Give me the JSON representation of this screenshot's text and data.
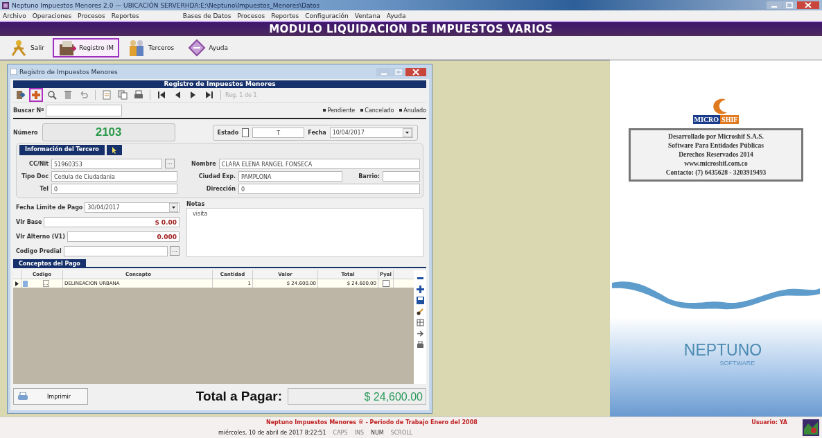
{
  "window": {
    "title": "Neptuno Impuestos Menores 2.0  —  UBICACIÓN SERVERHDA:E:\\Neptuno\\Impuestos_Menores\\Datos"
  },
  "menu_left": [
    "Archivo",
    "Operaciones",
    "Procesos",
    "Reportes"
  ],
  "menu_right": [
    "Bases de Datos",
    "Procesos",
    "Reportes",
    "Configuración",
    "Ventana",
    "Ayuda"
  ],
  "banner": "MODULO LIQUIDACION DE IMPUESTOS VARIOS",
  "toolbar": [
    {
      "kind": "exit",
      "label": "Salir",
      "selected": false
    },
    {
      "kind": "register",
      "label": "Registro IM",
      "selected": true
    },
    {
      "kind": "people",
      "label": "Terceros",
      "selected": false
    },
    {
      "kind": "help",
      "label": "Ayuda",
      "selected": false
    }
  ],
  "child_window": {
    "title": "Registro de Impuestos Menores",
    "header": "Registro de Impuestos Menores",
    "record_position": "Reg. 1 de 1",
    "tool_groups": [
      [
        {
          "kind": "exit",
          "selected": false
        },
        {
          "kind": "add",
          "selected": true
        },
        {
          "kind": "search",
          "selected": false
        },
        {
          "kind": "delete",
          "selected": false
        },
        {
          "kind": "undo",
          "selected": false
        }
      ],
      [
        {
          "kind": "doc",
          "selected": false
        },
        {
          "kind": "copy",
          "selected": false
        },
        {
          "kind": "print",
          "selected": false
        }
      ],
      [
        {
          "kind": "first",
          "selected": false
        },
        {
          "kind": "prev",
          "selected": false
        },
        {
          "kind": "next",
          "selected": false
        },
        {
          "kind": "last",
          "selected": false
        }
      ]
    ],
    "search": {
      "label": "Buscar Nº"
    },
    "legend": [
      "Pendiente",
      "Cancelado",
      "Anulado"
    ],
    "numero": {
      "label": "Número",
      "value": "2103"
    },
    "estado": {
      "label": "Estado",
      "checked": false,
      "value": "T"
    },
    "fecha": {
      "label": "Fecha",
      "value": "10/04/2017"
    },
    "tercero": {
      "header": "Información del Tercero",
      "cc": {
        "label": "CC/Nit",
        "value": "51960353",
        "button": "..."
      },
      "nombre": {
        "label": "Nombre",
        "value": "CLARA ELENA RANGEL  FONSECA"
      },
      "tipo_doc": {
        "label": "Tipo Doc",
        "value": "Cedula de Ciudadania"
      },
      "ciudad": {
        "label": "Ciudad Exp.",
        "value": "PAMPLONA"
      },
      "barrio": {
        "label": "Barrio:"
      },
      "tel": {
        "label": "Tel",
        "value": "0"
      },
      "direccion": {
        "label": "Dirección",
        "value": "0"
      }
    },
    "fecha_limite": {
      "label": "Fecha Limite de Pago",
      "value": "30/04/2017"
    },
    "vr_base": {
      "label": "Vlr Base",
      "value": "$ 0.00"
    },
    "vr_alterno": {
      "label": "Vlr Alterno (V1)",
      "value": "0.000"
    },
    "codigo_predial": {
      "label": "Codigo Predial",
      "button": "..."
    },
    "notas": {
      "label": "Notas",
      "value": "visita"
    },
    "conceptos": {
      "header": "Conceptos del Pago",
      "columns": [
        "Codigo",
        "Concepto",
        "Cantidad",
        "Valor",
        "Total",
        "Pyal"
      ],
      "rows": [
        {
          "button": "...",
          "concepto": "DELINEACION URBANA",
          "cantidad": "1",
          "valor": "$ 24.600,00",
          "total": "$ 24.600,00",
          "checked": false
        }
      ],
      "side_tools": [
        {
          "kind": "minus"
        },
        {
          "kind": "plus"
        },
        {
          "kind": "save"
        },
        {
          "kind": "brush"
        },
        {
          "kind": "grid"
        },
        {
          "kind": "arrow"
        },
        {
          "kind": "print"
        }
      ]
    },
    "print_button": "Imprimir",
    "total_label": "Total a Pagar:",
    "total_value": "$ 24,600.00"
  },
  "brand_panel": {
    "logo_a": "MICRO",
    "logo_b": "SHIF",
    "info": [
      "Desarrollado por Microshif S.A.S.",
      "Software Para Entidades Públicas",
      "Derechos Reservados 2014",
      "www.microshif.com.co",
      "Contacto: (7) 6435628 - 3203919493"
    ],
    "product": "NEPTUNO",
    "product_sub": "SOFTWARE"
  },
  "status_bar": {
    "message": "Neptuno Impuestos Menores ® - Periodo de Trabajo Enero del 2008",
    "user": "Usuario: YA",
    "datetime": "miércoles, 10 de abril de 2017 8:22:51",
    "indicators": [
      {
        "label": "CAPS",
        "on": false
      },
      {
        "label": "INS",
        "on": false
      },
      {
        "label": "NUM",
        "on": true
      },
      {
        "label": "SCROLL",
        "on": false
      }
    ]
  }
}
